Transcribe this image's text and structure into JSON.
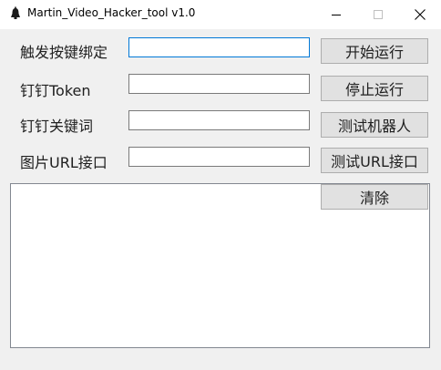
{
  "window": {
    "title": "Martin_Video_Hacker_tool v1.0",
    "app_icon": "bell-icon",
    "controls": {
      "minimize_icon": "minimize-icon",
      "maximize_icon": "maximize-icon",
      "close_icon": "close-icon"
    }
  },
  "form": {
    "rows": [
      {
        "label": "触发按键绑定",
        "value": "",
        "button": "开始运行"
      },
      {
        "label": "钉钉Token",
        "value": "",
        "button": "停止运行"
      },
      {
        "label": "钉钉关键词",
        "value": "",
        "button": "测试机器人"
      },
      {
        "label": "图片URL接口",
        "value": "",
        "button": "测试URL接口"
      }
    ]
  },
  "log": {
    "clear_button": "清除",
    "content": ""
  },
  "colors": {
    "focus_border": "#0078d7",
    "button_face": "#e1e1e1",
    "window_bg": "#f0f0f0"
  }
}
